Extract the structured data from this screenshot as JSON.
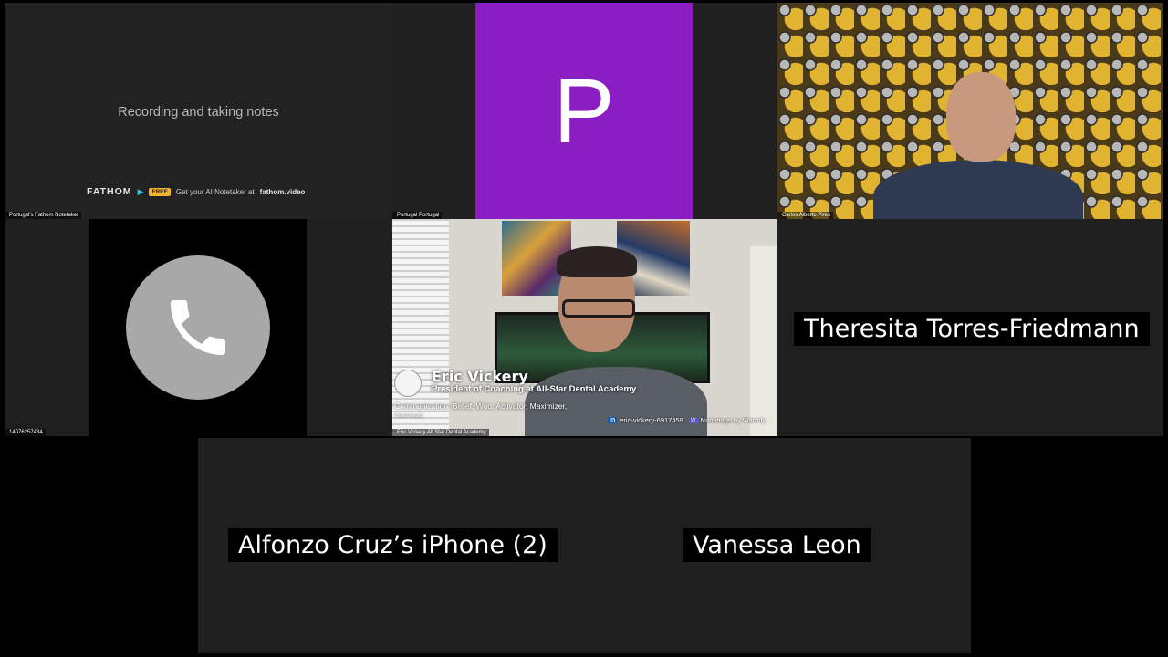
{
  "tiles": {
    "fathom": {
      "label": "Portugal's Fathom Notetaker",
      "status_text": "Recording and taking notes",
      "brand": "FATHOM",
      "badge": "FREE",
      "promo_prefix": "Get your AI Notetaker at",
      "promo_link": "fathom.video"
    },
    "portugal": {
      "label": "Portugal Portugal",
      "avatar_letter": "P",
      "avatar_color": "#8a1ec2"
    },
    "carlos": {
      "label": "Carlos Alberto Pires"
    },
    "phone": {
      "label": "14076257434",
      "icon": "phone-icon"
    },
    "eric": {
      "label": "Eric Vickery All Star Dental Academy",
      "nametag": {
        "name": "Eric Vickery",
        "title": "President of Coaching at All-Star Dental Academy",
        "strengths": "Communication, Belief, Woo, Activator, Maximizer,",
        "strengths_source": "CliftonStrengths",
        "linkedin_badge": "in",
        "linkedin_handle": "eric-vickery-6917459",
        "warmly_badge": "W",
        "branding": "Nametags by Warmly"
      }
    },
    "theresita": {
      "name": "Theresita Torres-Friedmann"
    },
    "alfonzo": {
      "name": "Alfonzo Cruz’s iPhone (2)"
    },
    "vanessa": {
      "name": "Vanessa Leon"
    }
  }
}
